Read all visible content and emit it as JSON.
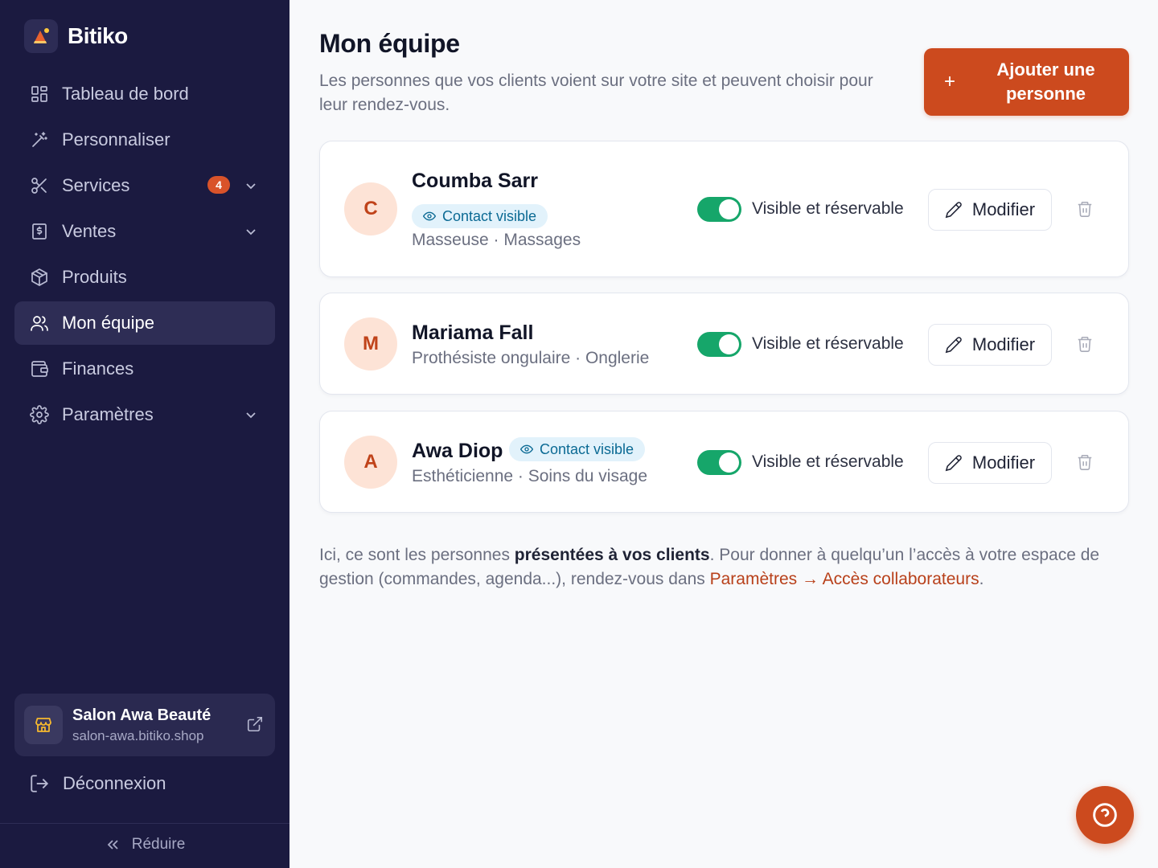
{
  "brand": {
    "name": "Bitiko",
    "icon": "bitiko-logo-icon"
  },
  "nav": {
    "items": [
      {
        "label": "Tableau de bord",
        "icon": "dashboard-icon"
      },
      {
        "label": "Personnaliser",
        "icon": "magic-wand-icon"
      },
      {
        "label": "Services",
        "icon": "scissors-icon",
        "badge": "4",
        "expandable": true
      },
      {
        "label": "Ventes",
        "icon": "receipt-icon",
        "expandable": true
      },
      {
        "label": "Produits",
        "icon": "box-icon"
      },
      {
        "label": "Mon équipe",
        "icon": "users-icon",
        "active": true
      },
      {
        "label": "Finances",
        "icon": "wallet-icon"
      },
      {
        "label": "Paramètres",
        "icon": "gear-icon",
        "expandable": true
      }
    ]
  },
  "salon": {
    "name": "Salon Awa Beauté",
    "url": "salon-awa.bitiko.shop"
  },
  "logout_label": "Déconnexion",
  "reduce_label": "Réduire",
  "header": {
    "title": "Mon équipe",
    "subtitle": "Les personnes que vos clients voient sur votre site et peuvent choisir pour leur rendez-vous.",
    "add_button": "Ajouter une personne",
    "add_icon": "+"
  },
  "team": [
    {
      "initial": "C",
      "name": "Coumba Sarr",
      "contact_badge": "Contact visible",
      "role": "Masseuse · Massages",
      "visibility": "Visible et réservable",
      "visible": true,
      "edit": "Modifier"
    },
    {
      "initial": "M",
      "name": "Mariama Fall",
      "contact_badge": "",
      "role": "Prothésiste ongulaire · Onglerie",
      "visibility": "Visible et réservable",
      "visible": true,
      "edit": "Modifier"
    },
    {
      "initial": "A",
      "name": "Awa Diop",
      "contact_badge": "Contact visible",
      "role": "Esthéticienne · Soins du visage",
      "visibility": "Visible et réservable",
      "visible": true,
      "edit": "Modifier"
    }
  ],
  "info": {
    "part1": "Ici, ce sont les personnes ",
    "bold": "présentées à vos clients",
    "part2": ". Pour donner à quelqu’un l’accès à votre espace de gestion (commandes, agenda...), rendez-vous dans ",
    "link": "Paramètres → Accès collaborateurs",
    "part3": "."
  },
  "colors": {
    "sidebar": "#1b1a40",
    "accent": "#cc4a1e",
    "toggle_on": "#16a66a",
    "badge_bg": "#e2f2fb"
  },
  "help_icon": "help-circle-icon"
}
